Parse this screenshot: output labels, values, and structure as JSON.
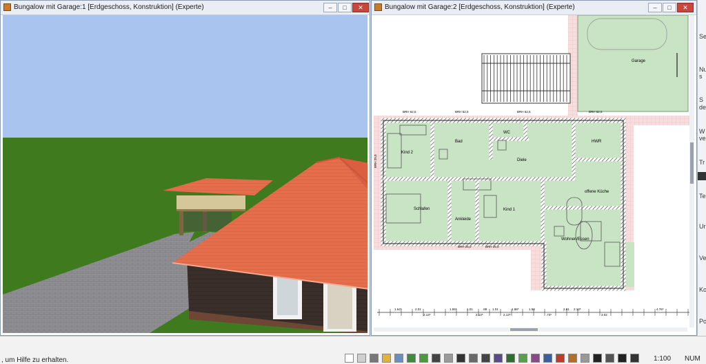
{
  "windows": {
    "view3d": {
      "title": "Bungalow mit Garage:1 [Erdgeschoss, Konstruktion] (Experte)"
    },
    "plan2d": {
      "title": "Bungalow mit Garage:2 [Erdgeschoss, Konstruktion] (Experte)",
      "rooms": {
        "garage": "Garage",
        "kind2": "Kind 2",
        "bad": "Bad",
        "wc": "WC",
        "hwr": "HWR",
        "diele": "Diele",
        "schlafen": "Schlafen",
        "ankleide": "Ankleide",
        "kind1": "Kind 1",
        "kueche": "offene Küche",
        "wohnen": "Wohnen/Essen"
      },
      "brh_labels": [
        "BRH 62,5",
        "BRH 62,5",
        "BRH 62,5",
        "BRH 62,5",
        "BRH 25,0",
        "BRH 25,0",
        "BRH 25,0"
      ],
      "dimensions": [
        "1.64⁵",
        "2.01",
        "2.13⁵",
        "1.55⁵",
        "1.01",
        "2.13⁵",
        ".88",
        "1.01",
        "2.13⁵",
        "1.88⁵",
        "1.58",
        ".73⁵",
        "2.01",
        "2.13⁵",
        "3.02",
        "4.76⁵"
      ]
    }
  },
  "controls": {
    "minimize": "–",
    "maximize": "□",
    "close": "✕"
  },
  "right_panel": {
    "items": [
      "Se",
      "Nu",
      "s",
      "S",
      "de",
      "W",
      "ver",
      "Tr",
      "Te",
      "Ur",
      "Ve",
      "Ko",
      "Po"
    ]
  },
  "status": {
    "help_text": ", um Hilfe zu erhalten.",
    "zoom": "1:100",
    "num": "NUM"
  },
  "colors": {
    "sky": "#a9c4ef",
    "grass": "#3f7a1e",
    "roof": "#e5704f",
    "wall": "#3a2e2a",
    "room_fill": "#c9e4c4",
    "wall_hatch": "#e8a8a8"
  },
  "statusbar_icons": [
    "rect-icon",
    "grid-icon",
    "table-icon",
    "pencil-icon",
    "cloud-icon",
    "terrain-icon",
    "plant-icon",
    "stairs-icon",
    "railing-icon",
    "people-icon",
    "furniture-icon",
    "bike-icon",
    "chair-icon",
    "tree-icon",
    "plant2-icon",
    "shrub-icon",
    "car-icon",
    "box-icon",
    "texture-icon",
    "stripes-icon",
    "text-abc-icon",
    "pin-icon",
    "text-abc-icon2",
    "camera-icon"
  ]
}
